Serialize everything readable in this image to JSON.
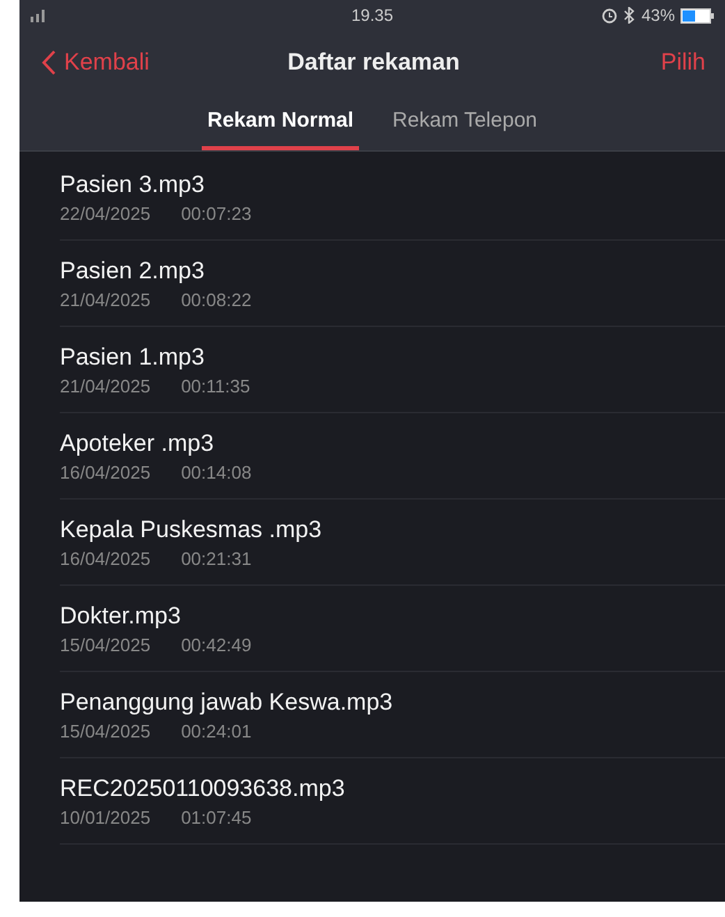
{
  "status_bar": {
    "time": "19.35",
    "battery": "43%"
  },
  "nav": {
    "back": "Kembali",
    "title": "Daftar rekaman",
    "action": "Pilih"
  },
  "tabs": [
    {
      "label": "Rekam Normal",
      "selected": true
    },
    {
      "label": "Rekam Telepon",
      "selected": false
    }
  ],
  "recordings": [
    {
      "name": "Pasien 3.mp3",
      "date": "22/04/2025",
      "duration": "00:07:23"
    },
    {
      "name": "Pasien 2.mp3",
      "date": "21/04/2025",
      "duration": "00:08:22"
    },
    {
      "name": "Pasien 1.mp3",
      "date": "21/04/2025",
      "duration": "00:11:35"
    },
    {
      "name": "Apoteker .mp3",
      "date": "16/04/2025",
      "duration": "00:14:08"
    },
    {
      "name": "Kepala Puskesmas .mp3",
      "date": "16/04/2025",
      "duration": "00:21:31"
    },
    {
      "name": "Dokter.mp3",
      "date": "15/04/2025",
      "duration": "00:42:49"
    },
    {
      "name": "Penanggung jawab Keswa.mp3",
      "date": "15/04/2025",
      "duration": "00:24:01"
    },
    {
      "name": "REC20250110093638.mp3",
      "date": "10/01/2025",
      "duration": "01:07:45"
    }
  ]
}
